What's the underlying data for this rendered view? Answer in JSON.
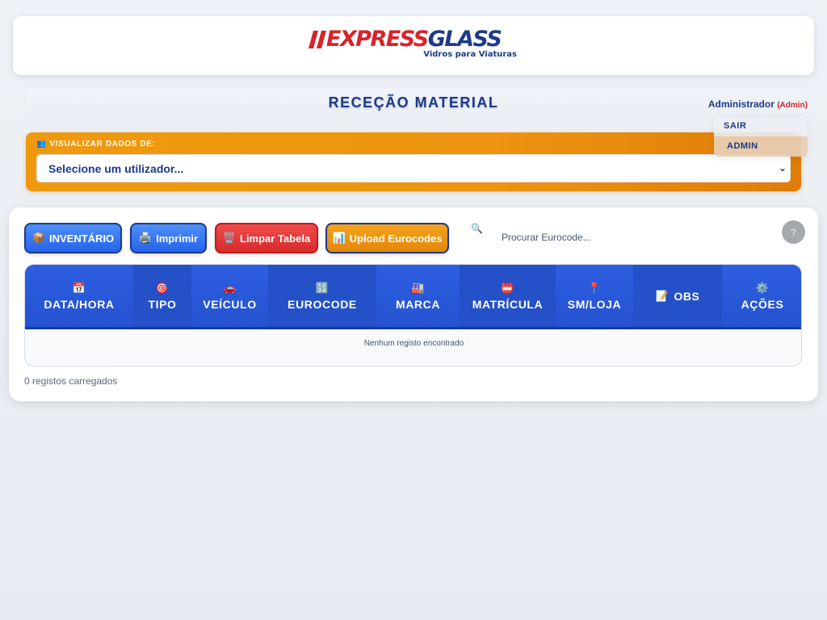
{
  "brand": {
    "name_part1": "EXPRESS",
    "name_part2": "GLASS",
    "tagline": "Vidros para Viaturas",
    "red": "#d8232a",
    "blue": "#1d3a8a"
  },
  "header": {
    "title": "RECEÇÃO MATERIAL",
    "user_name": "Administrador",
    "user_role": "(Admin)",
    "menu": [
      "SAIR",
      "ADMIN"
    ]
  },
  "viewer": {
    "icon": "users-icon",
    "label": "VISUALIZAR DADOS DE:",
    "select_value": "Selecione um utilizador..."
  },
  "toolbar": {
    "inventory": {
      "icon": "package-icon",
      "label": "INVENTÁRIO"
    },
    "print": {
      "icon": "printer-icon",
      "label": "Imprimir"
    },
    "clear": {
      "icon": "trash-icon",
      "label": "Limpar Tabela"
    },
    "upload": {
      "icon": "chart-icon",
      "label": "Upload Eurocodes"
    },
    "search_placeholder": "Procurar Eurocode...",
    "help": "?"
  },
  "table": {
    "columns": [
      {
        "icon": "calendar-icon",
        "label": "DATA/HORA"
      },
      {
        "icon": "target-icon",
        "label": "TIPO"
      },
      {
        "icon": "car-icon",
        "label": "VEÍCULO"
      },
      {
        "icon": "numbers-icon",
        "label": "EUROCODE"
      },
      {
        "icon": "factory-icon",
        "label": "MARCA"
      },
      {
        "icon": "plate-icon",
        "label": "MATRÍCULA"
      },
      {
        "icon": "pin-icon",
        "label": "SM/LOJA"
      },
      {
        "icon": "memo-icon",
        "label": "OBS"
      },
      {
        "icon": "gear-icon",
        "label": "AÇÕES"
      }
    ],
    "empty_message": "Nenhum registo encontrado"
  },
  "footer": {
    "count_text": "0 registos carregados"
  }
}
